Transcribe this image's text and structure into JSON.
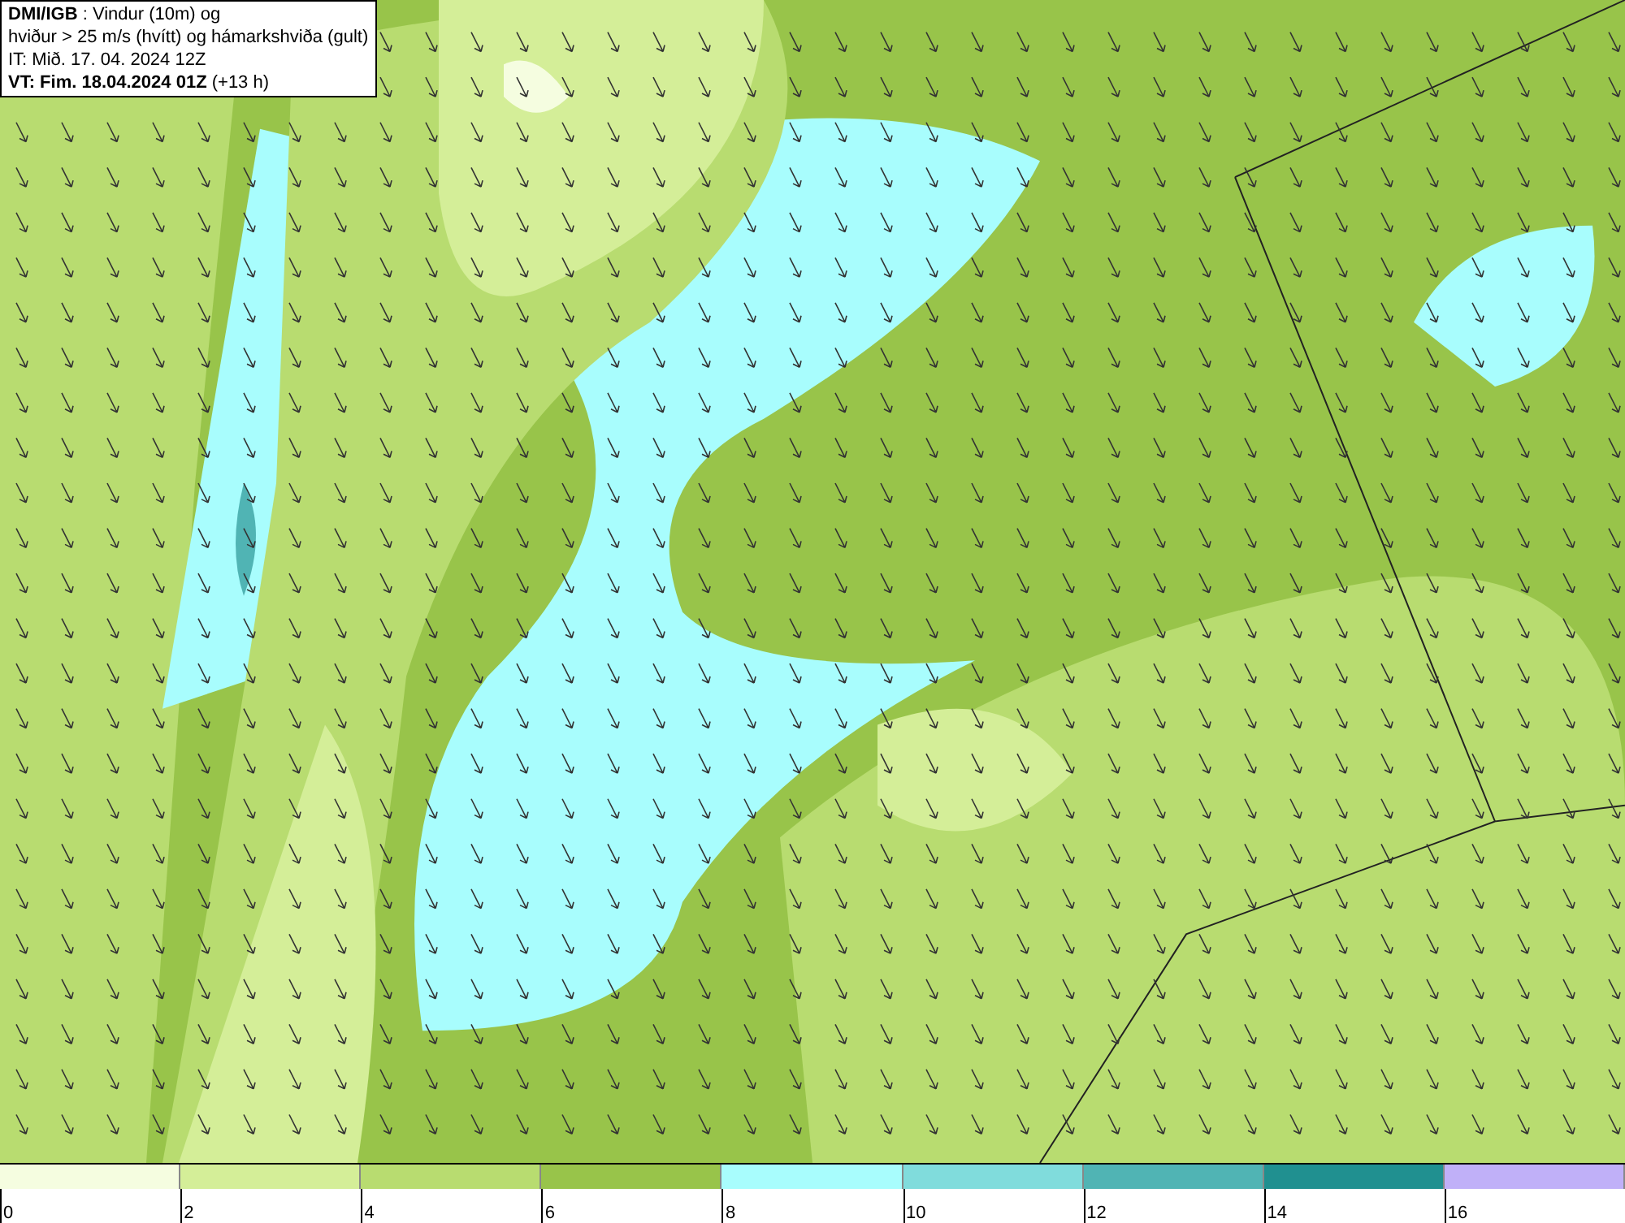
{
  "header": {
    "lines": [
      "**DMI/IGB** : Vindur (10m) og",
      "hviður > 25 m/s (hvítt) og hámarkshviða (gult)",
      "IT: Mið. 17. 04. 2024 12Z",
      "**VT: Fim. 18.04.2024 01Z** (+13 h)"
    ]
  },
  "legend": {
    "bins": [
      {
        "label": "0",
        "color": "#f5fde0"
      },
      {
        "label": "2",
        "color": "#d4ee98"
      },
      {
        "label": "4",
        "color": "#b8dc70"
      },
      {
        "label": "6",
        "color": "#98c44a"
      },
      {
        "label": "8",
        "color": "#a8fdfd"
      },
      {
        "label": "10",
        "color": "#80dcdc"
      },
      {
        "label": "12",
        "color": "#50b4b4"
      },
      {
        "label": "14",
        "color": "#209090"
      },
      {
        "label": "16",
        "color": "#c0b0f8"
      }
    ]
  }
}
